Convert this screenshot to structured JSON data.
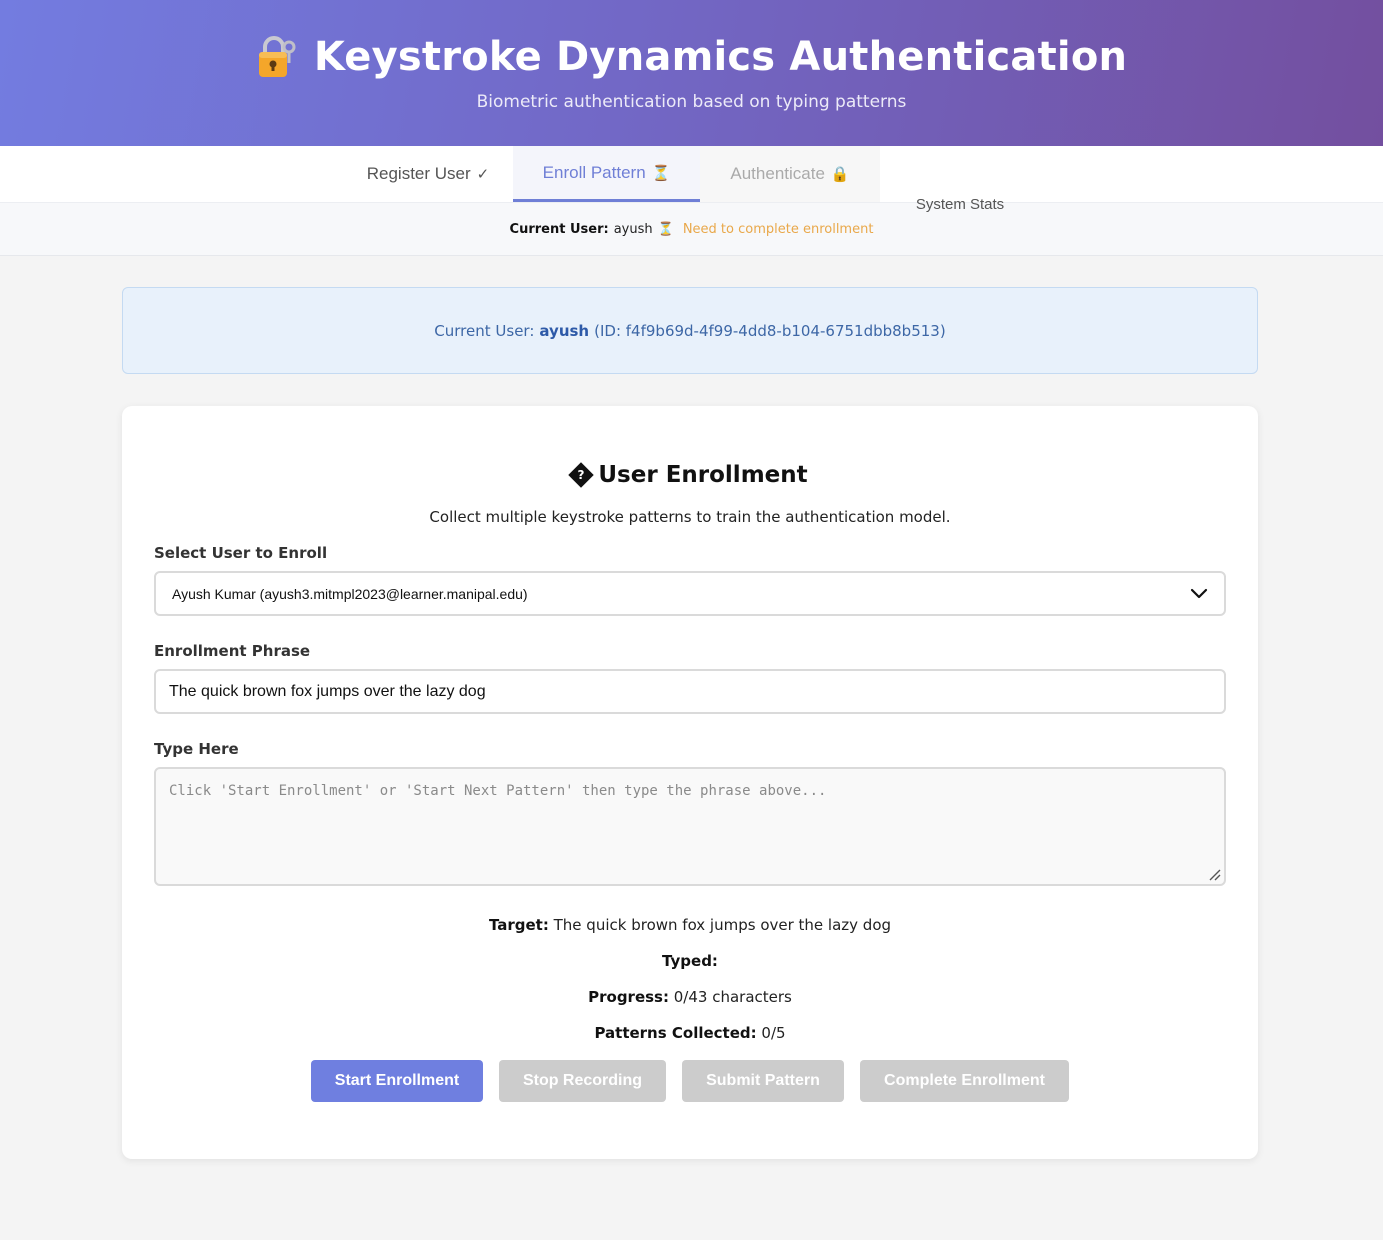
{
  "header": {
    "title": "Keystroke Dynamics Authentication",
    "subtitle": "Biometric authentication based on typing patterns",
    "icon": "lock-key-icon"
  },
  "tabs": [
    {
      "label": "Register User",
      "glyph": "✓"
    },
    {
      "label": "Enroll Pattern",
      "glyph": "⏳"
    },
    {
      "label": "Authenticate",
      "glyph": "🔒"
    },
    {
      "label": "System Stats",
      "glyph": ""
    }
  ],
  "status": {
    "label": "Current User:",
    "user": "ayush",
    "glyph": "⏳",
    "message": "Need to complete enrollment"
  },
  "info": {
    "prefix": "Current User:",
    "user": "ayush",
    "id_text": "(ID: f4f9b69d-4f99-4dd8-b104-6751dbb8b513)"
  },
  "enrollment": {
    "title": "User Enrollment",
    "description": "Collect multiple keystroke patterns to train the authentication model.",
    "select_label": "Select User to Enroll",
    "selected_user": "Ayush Kumar (ayush3.mitmpl2023@learner.manipal.edu)",
    "phrase_label": "Enrollment Phrase",
    "phrase_value": "The quick brown fox jumps over the lazy dog",
    "type_label": "Type Here",
    "type_placeholder": "Click 'Start Enrollment' or 'Start Next Pattern' then type the phrase above...",
    "target_label": "Target:",
    "target_value": "The quick brown fox jumps over the lazy dog",
    "typed_label": "Typed:",
    "typed_value": "",
    "progress_label": "Progress:",
    "progress_value": "0/43 characters",
    "patterns_label": "Patterns Collected:",
    "patterns_value": "0/5"
  },
  "buttons": {
    "start": "Start Enrollment",
    "stop": "Stop Recording",
    "submit": "Submit Pattern",
    "complete": "Complete Enrollment"
  },
  "colors": {
    "accent": "#6f7fe0",
    "warning": "#e9a84a",
    "info_text": "#3d67a6"
  }
}
